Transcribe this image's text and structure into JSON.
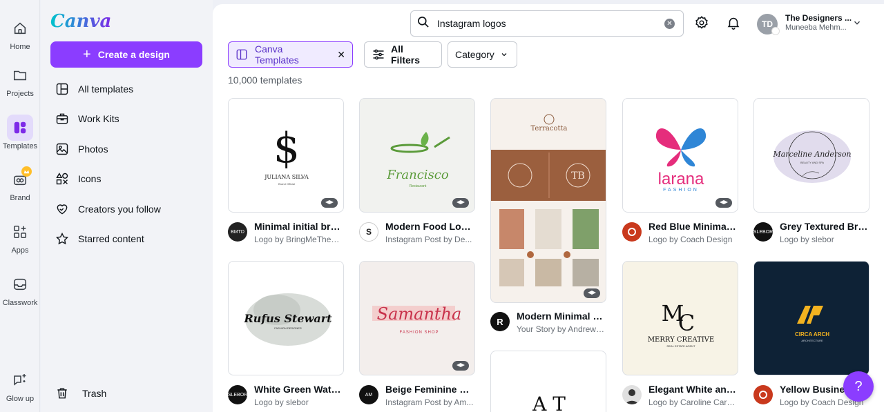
{
  "rail": {
    "home": "Home",
    "projects": "Projects",
    "templates": "Templates",
    "brand": "Brand",
    "apps": "Apps",
    "classwork": "Classwork",
    "glow_up": "Glow up"
  },
  "sidebar": {
    "logo": "Canva",
    "create_label": "Create a design",
    "items": [
      {
        "label": "All templates",
        "icon": "all-templates-icon"
      },
      {
        "label": "Work Kits",
        "icon": "briefcase-icon"
      },
      {
        "label": "Photos",
        "icon": "photo-icon"
      },
      {
        "label": "Icons",
        "icon": "shapes-icon"
      },
      {
        "label": "Creators you follow",
        "icon": "heart-icon"
      },
      {
        "label": "Starred content",
        "icon": "star-icon"
      }
    ],
    "trash": "Trash"
  },
  "header": {
    "search_value": "Instagram logos",
    "avatar_initials": "TD",
    "account_name": "The Designers ...",
    "account_user": "Muneeba Mehm..."
  },
  "filters": {
    "selected_chip": "Canva Templates",
    "all_filters": "All Filters",
    "category": "Category"
  },
  "result_count": "10,000 templates",
  "cards": [
    {
      "title": "Minimal initial bra...",
      "sub": "Logo by BringMeTheD...",
      "thumb_text": "JULIANA SILVA",
      "thumb_sub": "Brand Official"
    },
    {
      "title": "Modern Food Log...",
      "sub": "Instagram Post by De...",
      "thumb_text": "Francisco",
      "thumb_sub": "Restaurant"
    },
    {
      "title": "Modern Minimal B...",
      "sub": "Your Story by Andrew ...",
      "thumb_text": "Terracotta",
      "thumb_sub": "TB"
    },
    {
      "title": "Red Blue Minimali...",
      "sub": "Logo by Coach Design",
      "thumb_text": "larana",
      "thumb_sub": "FASHION"
    },
    {
      "title": "Grey Textured Bru...",
      "sub": "Logo by slebor",
      "thumb_text": "Marceline Anderson",
      "thumb_sub": "BEAUTY AND SPA"
    },
    {
      "title": "White Green Wate...",
      "sub": "Logo by slebor",
      "thumb_text": "Rufus Stewart",
      "thumb_sub": "FASHION DESIGNER"
    },
    {
      "title": "Beige Feminine Be...",
      "sub": "Instagram Post by Am...",
      "thumb_text": "Samantha",
      "thumb_sub": "FASHION SHOP"
    },
    {
      "title": "Elegant White and ...",
      "sub": "Logo by Caroline Carri...",
      "thumb_text": "MERRY CREATIVE",
      "thumb_sub": "REAL ESTATE AGENT"
    },
    {
      "title": "Yellow Busines...",
      "sub": "Logo by Coach Design",
      "thumb_text": "CIRCA ARCH",
      "thumb_sub": "ARCHITECTURE"
    }
  ],
  "help_label": "?",
  "colors": {
    "accent": "#8b3dff",
    "bg": "#f2f3f7"
  }
}
